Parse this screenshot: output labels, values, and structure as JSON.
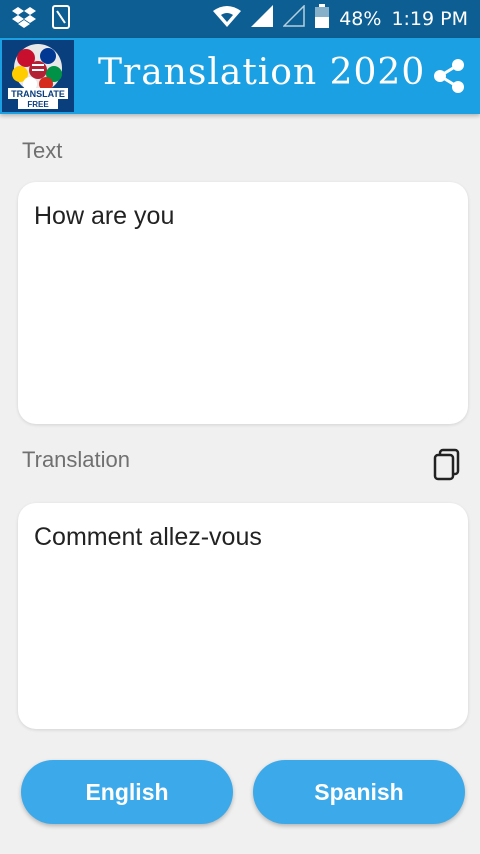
{
  "status_bar": {
    "battery_percent": "48%",
    "time": "1:19 PM",
    "icons": [
      "dropbox-icon",
      "sim-notification-icon",
      "wifi-icon",
      "signal-icon",
      "signal-empty-icon",
      "battery-icon"
    ]
  },
  "app_bar": {
    "title": "Translation 2020",
    "logo_text_line1": "TRANSLATE",
    "logo_text_line2": "FREE",
    "share_icon": "share-icon",
    "color": "#1aa0e3"
  },
  "source": {
    "label": "Text",
    "value": "How are you"
  },
  "result": {
    "label": "Translation",
    "value": "Comment allez-vous",
    "copy_icon": "copy-icon"
  },
  "languages": {
    "source_button": "English",
    "target_button": "Spanish",
    "button_color": "#3caaea"
  }
}
